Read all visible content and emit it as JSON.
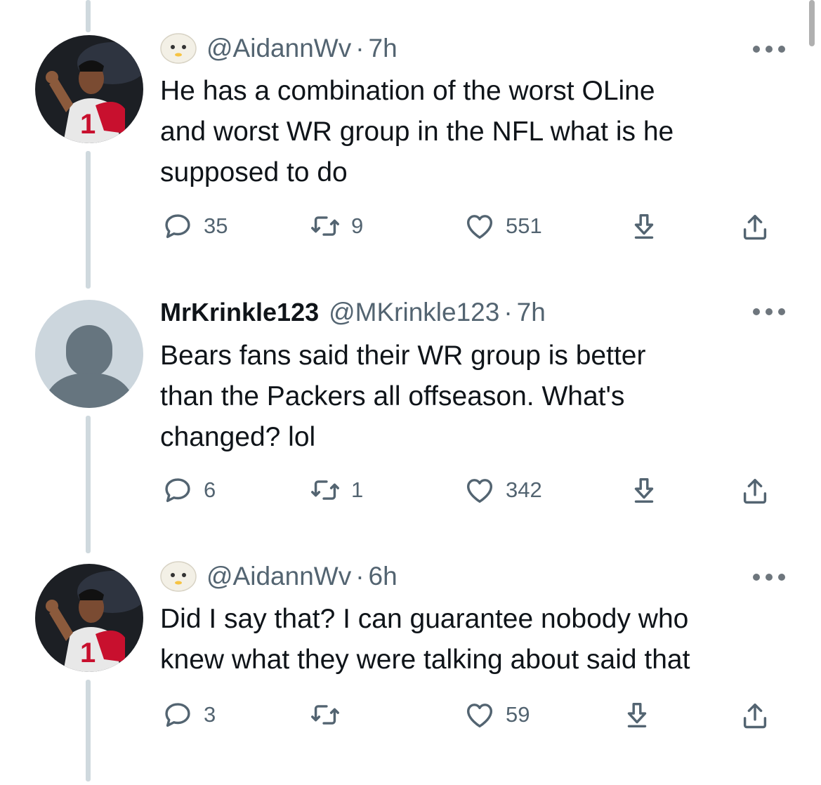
{
  "tweets": [
    {
      "display_name": "",
      "handle": "@AidannWv",
      "separator": "·",
      "time": "7h",
      "text": "He has a combination of the worst OLine\nand worst WR group in the NFL what is he\nsupposed to do",
      "counts": {
        "replies": "35",
        "retweets": "9",
        "likes": "551"
      }
    },
    {
      "display_name": "MrKrinkle123",
      "handle": "@MKrinkle123",
      "separator": "·",
      "time": "7h",
      "text": "Bears fans said their WR group is better\nthan the Packers all offseason. What's\nchanged? lol",
      "counts": {
        "replies": "6",
        "retweets": "1",
        "likes": "342"
      }
    },
    {
      "display_name": "",
      "handle": "@AidannWv",
      "separator": "·",
      "time": "6h",
      "text": "Did I say that? I can guarantee nobody who\nknew what they were talking about said that",
      "counts": {
        "replies": "3",
        "retweets": "",
        "likes": "59"
      }
    }
  ],
  "icons": {
    "reply": "reply-icon",
    "retweet": "retweet-icon",
    "like": "heart-icon",
    "download": "download-icon",
    "share": "share-icon",
    "more": "more-icon",
    "emoji": "face-emoji-icon"
  },
  "colors": {
    "text": "#0f1419",
    "secondary": "#536471",
    "thread_line": "#cfd9de",
    "default_avatar_bg": "#ccd6dd",
    "default_avatar_fg": "#66757f"
  }
}
